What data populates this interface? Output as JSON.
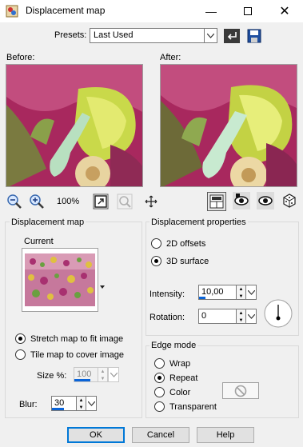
{
  "window": {
    "title": "Displacement map"
  },
  "presets": {
    "label": "Presets:",
    "value": "Last Used"
  },
  "preview": {
    "before_label": "Before:",
    "after_label": "After:",
    "zoom": "100%"
  },
  "displacement_map": {
    "title": "Displacement map",
    "current_label": "Current",
    "stretch_label": "Stretch map to fit image",
    "tile_label": "Tile map to cover image",
    "size_label": "Size %:",
    "size_value": "100",
    "blur_label": "Blur:",
    "blur_value": "30"
  },
  "properties": {
    "title": "Displacement properties",
    "offsets_label": "2D offsets",
    "surface_label": "3D surface",
    "intensity_label": "Intensity:",
    "intensity_value": "10,00",
    "rotation_label": "Rotation:",
    "rotation_value": "0"
  },
  "edge_mode": {
    "title": "Edge mode",
    "wrap": "Wrap",
    "repeat": "Repeat",
    "color": "Color",
    "transparent": "Transparent"
  },
  "buttons": {
    "ok": "OK",
    "cancel": "Cancel",
    "help": "Help"
  },
  "colors": {
    "accent": "#0078d7",
    "slider_fill": "#0a64d8"
  }
}
